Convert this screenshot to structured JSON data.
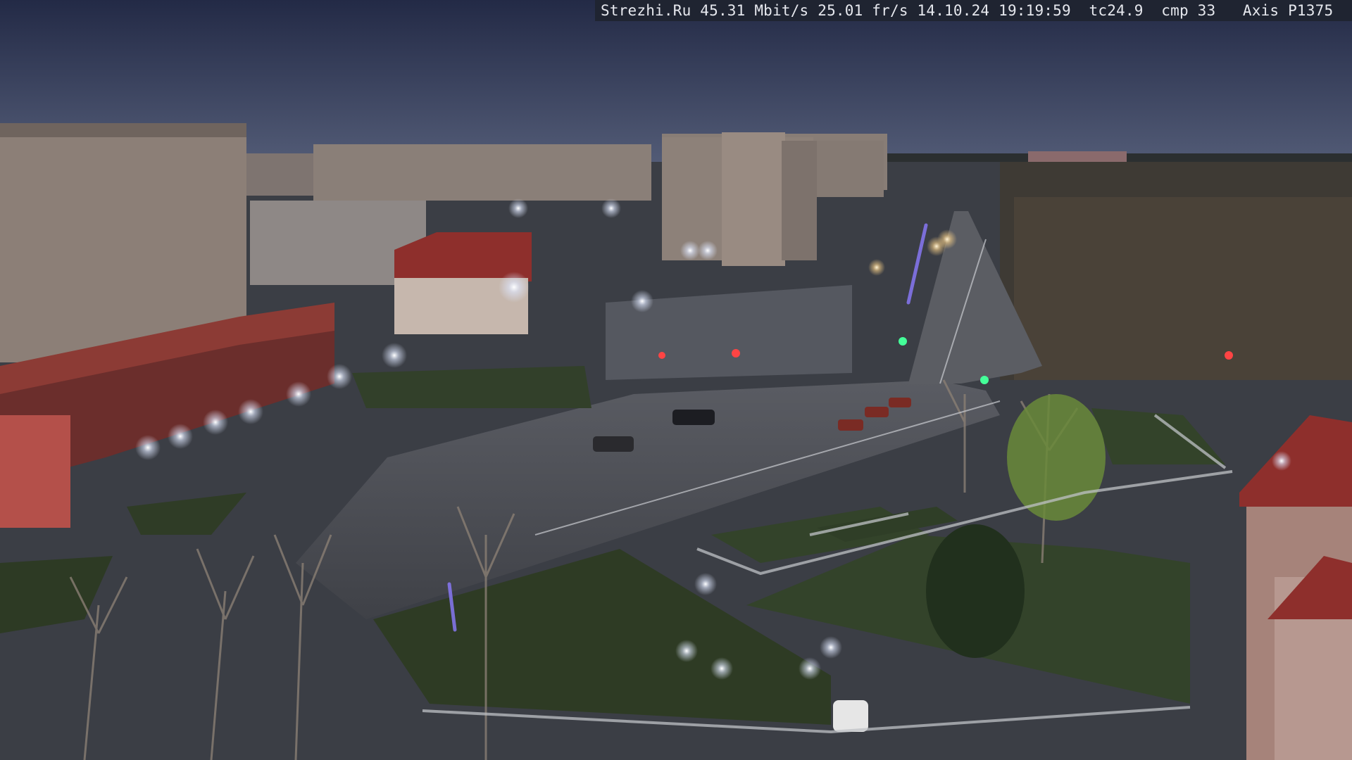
{
  "camera_overlay": {
    "text": "Strezhi.Ru 45.31 Mbit/s 25.01 fr/s 14.10.24 19:19:59  tc24.9  cmp 33   Axis P1375"
  },
  "scene": {
    "description_colors": {
      "sky_top": "#27304f",
      "sky_bottom": "#4a5472",
      "ground": "#3a3d45",
      "road": "#4a4c53",
      "grass": "#2f3d22",
      "building_light": "#8b7f78",
      "building_red": "#9b3a34"
    }
  }
}
